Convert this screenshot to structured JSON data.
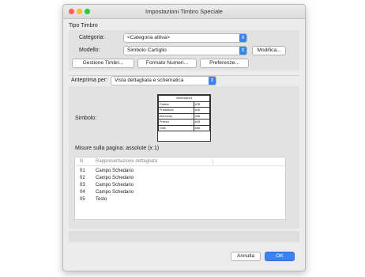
{
  "window": {
    "title": "Impostazioni Timbro Speciale"
  },
  "tipo_timbro": {
    "section_label": "Tipo Timbro",
    "categoria_label": "Categoria:",
    "categoria_value": "<Categoria attiva>",
    "modello_label": "Modello:",
    "modello_value": "Simbolo Cartiglio",
    "modifica_button": "Modifica...",
    "gestione_button": "Gestione Timbri...",
    "formato_button": "Formato Numeri...",
    "preferenze_button": "Preferenze..."
  },
  "anteprima": {
    "label": "Anteprima per:",
    "value": "Vista dettagliata e schematica"
  },
  "simbolo": {
    "label": "Simbolo:",
    "preview": {
      "header": "Informazioni",
      "rows": [
        {
          "name": "Codice",
          "value": "#78"
        },
        {
          "name": "Produttore",
          "value": "#26"
        },
        {
          "name": "Elemento",
          "value": "#36"
        },
        {
          "name": "Prezzo",
          "value": "#48"
        },
        {
          "name": "Note",
          "value": "#58"
        }
      ]
    }
  },
  "misure": {
    "text": "Misure sulla pagina:  assolute (x 1)"
  },
  "list": {
    "columns": [
      "N",
      "Rappresentazione dettagliata"
    ],
    "rows": [
      {
        "n": "01",
        "label": "Campo Schedario"
      },
      {
        "n": "02",
        "label": "Campo Schedario"
      },
      {
        "n": "03",
        "label": "Campo Schedario"
      },
      {
        "n": "04",
        "label": "Campo Schedario"
      },
      {
        "n": "05",
        "label": "Testo"
      }
    ]
  },
  "footer": {
    "cancel": "Annulla",
    "ok": "OK"
  },
  "colors": {
    "accent": "#3a84f2",
    "close": "#fc5f57",
    "minimize": "#fdbc2e",
    "zoom": "#2ac940"
  }
}
